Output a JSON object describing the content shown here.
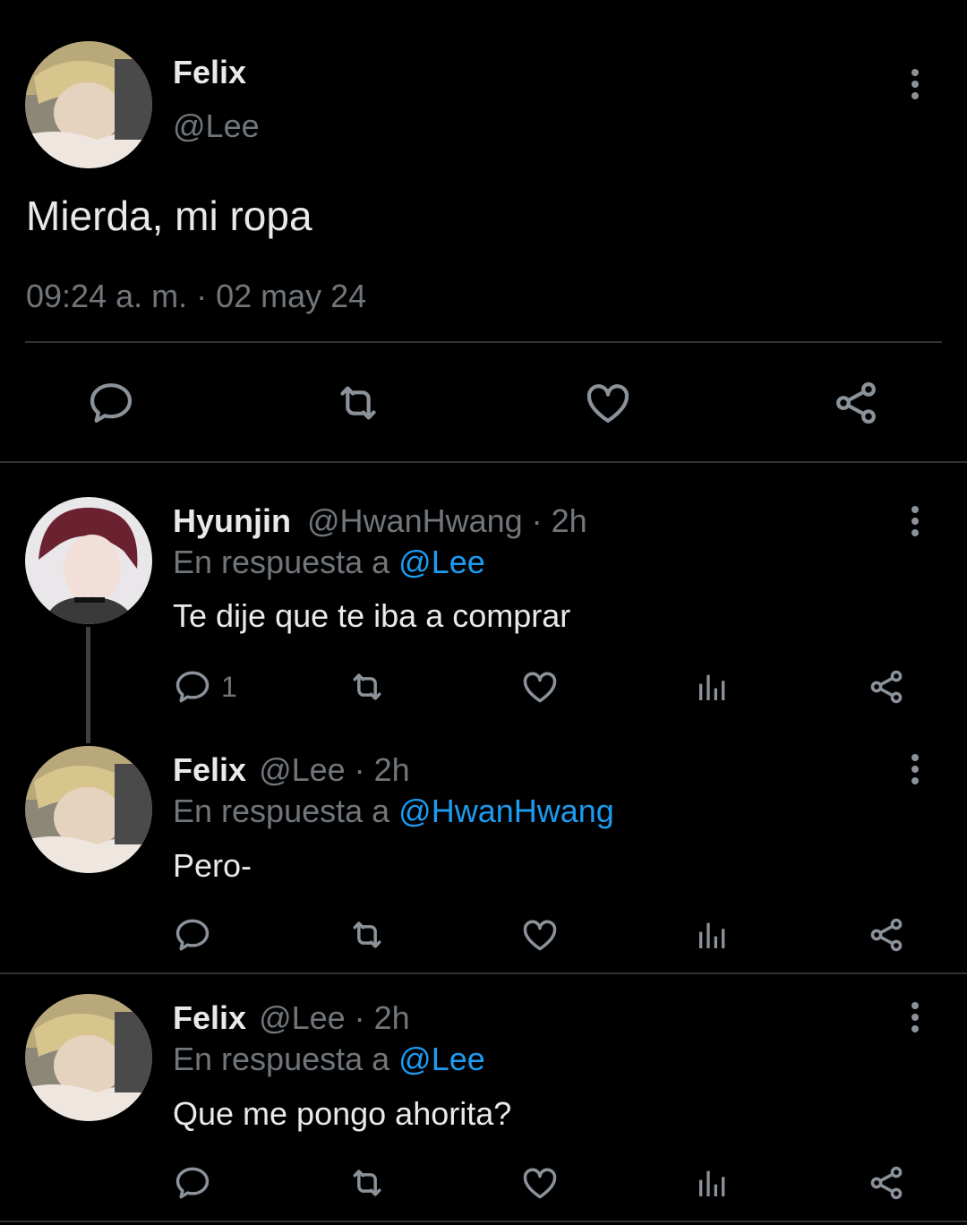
{
  "main_tweet": {
    "author_name": "Felix",
    "author_handle": "@Lee",
    "text": "Mierda, mi ropa",
    "timestamp": "09:24 a. m. · 02 may 24"
  },
  "replies": [
    {
      "author_name": "Hyunjin",
      "meta": "@HwanHwang · 2h",
      "reply_prefix": "En respuesta a",
      "reply_to": "@Lee",
      "text": "Te dije que te iba a comprar",
      "reply_count": "1"
    },
    {
      "author_name": "Felix",
      "meta": "@Lee · 2h",
      "reply_prefix": "En respuesta a",
      "reply_to": "@HwanHwang",
      "text": "Pero-",
      "reply_count": ""
    },
    {
      "author_name": "Felix",
      "meta": "@Lee · 2h",
      "reply_prefix": "En respuesta a",
      "reply_to": "@Lee",
      "text": "Que me pongo ahorita?",
      "reply_count": ""
    }
  ],
  "colors": {
    "background": "#000000",
    "text": "#e7e9ea",
    "muted": "#71767b",
    "link": "#1d9bf0",
    "divider": "#2f3336"
  },
  "icons": [
    "reply-icon",
    "retweet-icon",
    "like-icon",
    "views-icon",
    "share-icon",
    "more-icon"
  ]
}
